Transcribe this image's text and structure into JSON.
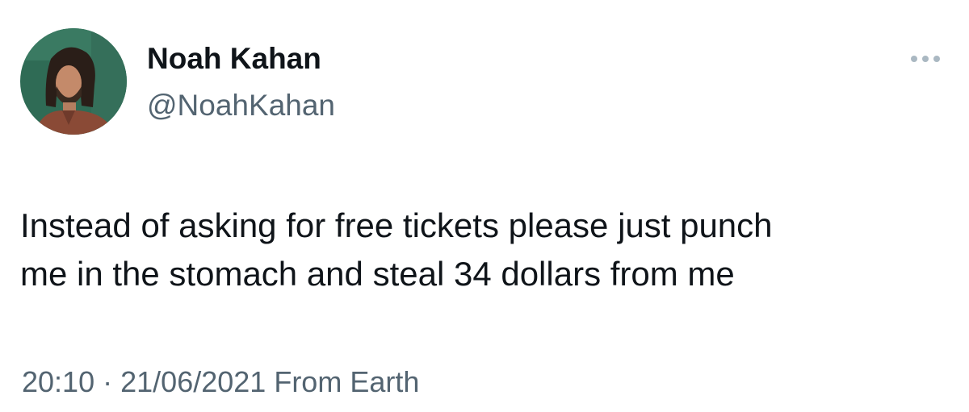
{
  "author": {
    "display_name": "Noah Kahan",
    "handle": "@NoahKahan"
  },
  "tweet": {
    "text_line1": "Instead of asking for free tickets please just punch",
    "text_line2": "me in the stomach and steal 34 dollars from me"
  },
  "meta": {
    "time": "20:10",
    "separator": "·",
    "date": "21/06/2021",
    "source": "From Earth"
  },
  "icons": {
    "more": "more-horizontal-icon",
    "avatar": "profile-photo"
  },
  "colors": {
    "primary_text": "#0f1419",
    "secondary_text": "#536471",
    "more_icon": "#aab8c2"
  }
}
